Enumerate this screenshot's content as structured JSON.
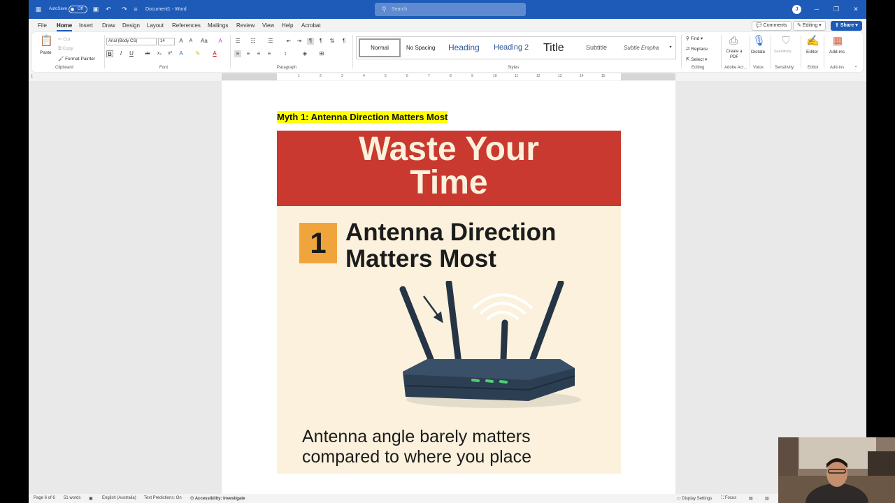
{
  "titlebar": {
    "autosave_label": "AutoSave",
    "autosave_state": "Off",
    "doc_title": "Document1 - Word",
    "search_placeholder": "Search",
    "avatar_initial": "J"
  },
  "menu": {
    "tabs": [
      "File",
      "Home",
      "Insert",
      "Draw",
      "Design",
      "Layout",
      "References",
      "Mailings",
      "Review",
      "View",
      "Help",
      "Acrobat"
    ],
    "active_tab": "Home",
    "comments_label": "Comments",
    "editing_label": "Editing",
    "share_label": "Share"
  },
  "ribbon": {
    "clipboard": {
      "paste": "Paste",
      "cut": "Cut",
      "copy": "Copy",
      "format_painter": "Format Painter",
      "label": "Clipboard"
    },
    "font": {
      "font_name": "Arial (Body CS)",
      "font_size": "14",
      "label": "Font"
    },
    "paragraph": {
      "label": "Paragraph"
    },
    "styles": {
      "items": [
        "Normal",
        "No Spacing",
        "Heading",
        "Heading 2",
        "Title",
        "Subtitle",
        "Subtle Empha"
      ],
      "label": "Styles"
    },
    "editing": {
      "find": "Find",
      "replace": "Replace",
      "select": "Select",
      "label": "Editing"
    },
    "adobe": {
      "button": "Create a PDF",
      "label": "Adobe Acr..."
    },
    "voice": {
      "button": "Dictate",
      "label": "Voice"
    },
    "sensitivity": {
      "button": "Sensitivity",
      "label": "Sensitivity"
    },
    "editor": {
      "button": "Editor",
      "label": "Editor"
    },
    "addins": {
      "button": "Add-ins",
      "label": "Add-ins"
    }
  },
  "ruler": {
    "ticks": [
      "1",
      "2",
      "3",
      "4",
      "5",
      "6",
      "7",
      "8",
      "9",
      "10",
      "11",
      "12",
      "13",
      "14",
      "15"
    ]
  },
  "document": {
    "heading": "Myth 1: Antenna Direction Matters Most",
    "infographic": {
      "banner_line1": "Waste Your",
      "banner_line2": "Time",
      "myth_number": "1",
      "myth_title_line1": "Antenna Direction",
      "myth_title_line2": "Matters Most",
      "caption_line1": "Antenna angle barely matters",
      "caption_line2": "compared to where you place"
    }
  },
  "statusbar": {
    "page": "Page 6 of 6",
    "words": "51 words",
    "language": "English (Australia)",
    "predictions": "Text Predictions: On",
    "accessibility": "Accessibility: Investigate",
    "display_settings": "Display Settings",
    "focus": "Focus"
  },
  "colors": {
    "titlebar": "#1e5bb8",
    "banner": "#c9392f",
    "infographic_bg": "#fbf1dc",
    "number_badge": "#f0a53c",
    "highlight": "#ffff00"
  }
}
